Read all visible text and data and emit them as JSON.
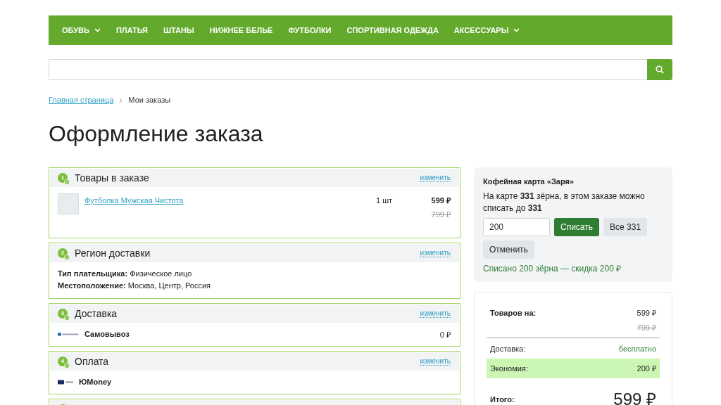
{
  "nav": {
    "items": [
      {
        "label": "ОБУВЬ",
        "dropdown": true
      },
      {
        "label": "ПЛАТЬЯ",
        "dropdown": false
      },
      {
        "label": "ШТАНЫ",
        "dropdown": false
      },
      {
        "label": "НИЖНЕЕ БЕЛЬЕ",
        "dropdown": false
      },
      {
        "label": "ФУТБОЛКИ",
        "dropdown": false
      },
      {
        "label": "СПОРТИВНАЯ ОДЕЖДА",
        "dropdown": false
      },
      {
        "label": "АКСЕССУАРЫ",
        "dropdown": true
      }
    ]
  },
  "breadcrumbs": [
    {
      "label": "Главная страница",
      "link": true
    },
    {
      "label": "Мои заказы",
      "link": false
    }
  ],
  "title": "Оформление заказа",
  "sections": [
    {
      "kind": "items",
      "step": "1",
      "title": "Товары в заказе",
      "edit": "изменить",
      "products": [
        {
          "name": "Футболка Мужская Чистота",
          "qty": "1 шт",
          "price": "599 ₽",
          "old_price": "799 ₽"
        }
      ]
    },
    {
      "kind": "props",
      "step": "2",
      "title": "Регион доставки",
      "edit": "изменить",
      "lines": [
        "**Тип плательщика:** Физическое лицо",
        "**Местоположение:** Москва, Центр, Россия"
      ]
    },
    {
      "kind": "delivery",
      "step": "3",
      "title": "Доставка",
      "edit": "изменить",
      "option": {
        "name": "Самовывоз",
        "price": "0 ₽"
      }
    },
    {
      "kind": "payment",
      "step": "4",
      "title": "Оплата",
      "edit": "изменить",
      "option": {
        "name": "ЮMoney"
      }
    },
    {
      "kind": "partial"
    }
  ],
  "loyalty": {
    "title": "Кофейная карта «Заря»",
    "text": "На карте **331** зёрна, в этом заказе можно списать до **331**",
    "input_value": "200",
    "buttons": [
      {
        "label": "Списать",
        "kind": "primary"
      },
      {
        "label": "Все 331",
        "kind": "secondary"
      },
      {
        "label": "Отменить",
        "kind": "secondary"
      }
    ],
    "status": "Списано 200 зёрна — скидка 200 ₽"
  },
  "summary": {
    "rows": [
      {
        "kind": "subtotal",
        "label": "Товаров на:",
        "value": "599 ₽",
        "old_value": "799 ₽"
      },
      {
        "kind": "plain",
        "label": "Доставка:",
        "value": "бесплатно"
      },
      {
        "kind": "highlight",
        "label": "Экономия:",
        "value": "200 ₽"
      },
      {
        "kind": "total",
        "label": "Итого:",
        "value": "599 ₽"
      }
    ]
  }
}
